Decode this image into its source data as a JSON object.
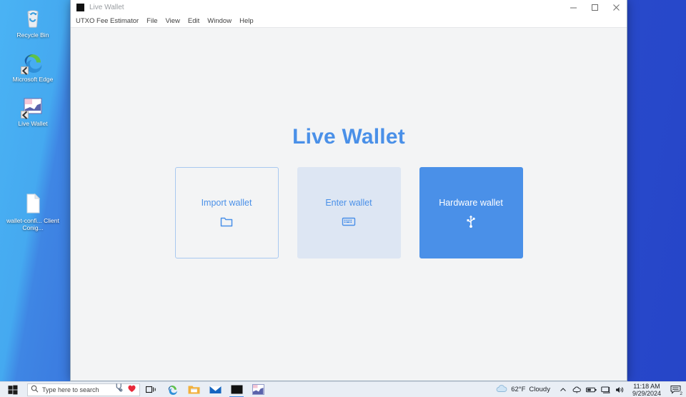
{
  "desktop": {
    "icons": [
      {
        "name": "recycle-bin",
        "label": "Recycle Bin",
        "icon": "recycle-bin-icon",
        "shortcut": false
      },
      {
        "name": "microsoft-edge",
        "label": "Microsoft Edge",
        "icon": "edge-icon",
        "shortcut": true
      },
      {
        "name": "live-wallet",
        "label": "Live Wallet",
        "icon": "chart-app-icon",
        "shortcut": true
      },
      {
        "name": "wallet-config-file",
        "label": "wallet-confi... Client Conig...",
        "icon": "document-icon",
        "shortcut": false
      }
    ]
  },
  "window": {
    "title": "Live Wallet",
    "app_icon": "black-square-icon",
    "controls": {
      "minimize": "minimize-icon",
      "maximize": "maximize-icon",
      "close": "close-icon"
    },
    "menu": [
      {
        "label": "UTXO Fee Estimator"
      },
      {
        "label": "File"
      },
      {
        "label": "View"
      },
      {
        "label": "Edit"
      },
      {
        "label": "Window"
      },
      {
        "label": "Help"
      }
    ],
    "heading": "Live Wallet",
    "cards": [
      {
        "label": "Import wallet",
        "icon": "folder-icon",
        "style": "outline"
      },
      {
        "label": "Enter wallet",
        "icon": "keyboard-icon",
        "style": "filled"
      },
      {
        "label": "Hardware wallet",
        "icon": "usb-icon",
        "style": "solid"
      }
    ]
  },
  "taskbar": {
    "start": "windows-start-icon",
    "search": {
      "icon": "search-icon",
      "placeholder": "Type here to search",
      "value": "Type here to search",
      "extra_icons": [
        "stethoscope-icon",
        "heart-icon"
      ]
    },
    "pinned": [
      {
        "name": "task-view",
        "icon": "task-view-icon",
        "active": false
      },
      {
        "name": "microsoft-edge",
        "icon": "edge-icon",
        "active": false
      },
      {
        "name": "file-explorer",
        "icon": "folder-icon",
        "active": false
      },
      {
        "name": "mail",
        "icon": "mail-icon",
        "active": false
      },
      {
        "name": "live-wallet-window",
        "icon": "black-square-icon",
        "active": true
      },
      {
        "name": "chart-app",
        "icon": "chart-app-icon",
        "active": false
      }
    ],
    "tray": {
      "weather_icon": "cloud-icon",
      "temperature": "62°F",
      "condition": "Cloudy",
      "icons": [
        "chevron-up-icon",
        "onedrive-icon",
        "battery-icon",
        "network-icon",
        "volume-icon"
      ],
      "time": "11:18 AM",
      "date": "9/29/2024",
      "notification_icon": "notification-icon",
      "notification_count": "2"
    }
  },
  "colors": {
    "accent": "#4a90e8",
    "card_filled": "#dde6f3",
    "card_border": "#a8c8f0",
    "window_bg": "#f3f4f5",
    "taskbar_bg": "#e9eef5"
  }
}
